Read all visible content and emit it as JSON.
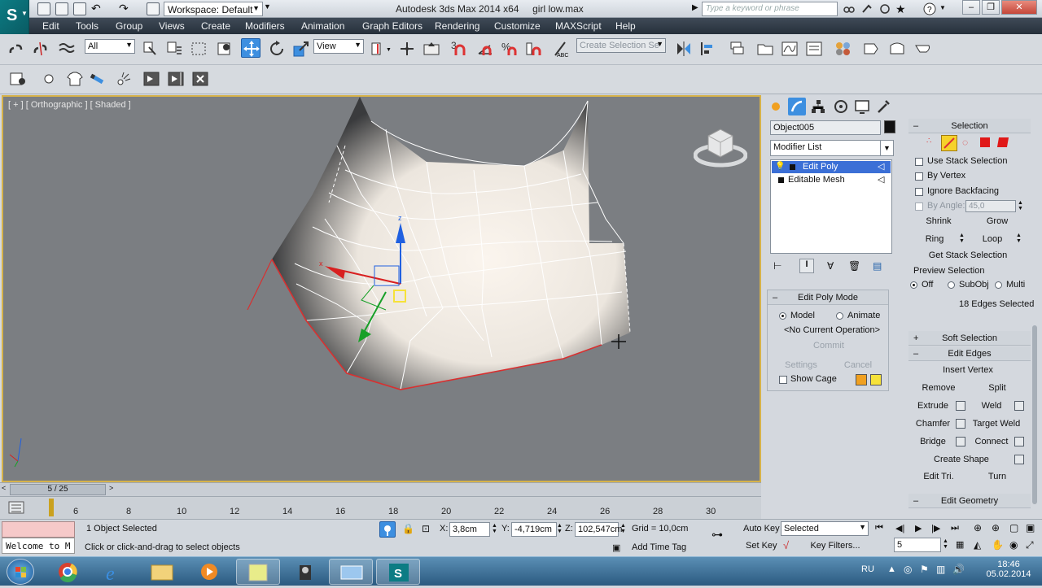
{
  "titlebar": {
    "workspace": "Workspace: Default",
    "app_title": "Autodesk 3ds Max  2014 x64",
    "file_name": "girl low.max",
    "search_placeholder": "Type a keyword or phrase"
  },
  "menu": [
    "Edit",
    "Tools",
    "Group",
    "Views",
    "Create",
    "Modifiers",
    "Animation",
    "Graph Editors",
    "Rendering",
    "Customize",
    "MAXScript",
    "Help"
  ],
  "toolbar": {
    "selection_filter": "All",
    "ref_coord": "View",
    "named_selection_placeholder": "Create Selection Se",
    "snap_number": "3"
  },
  "viewport": {
    "label": "[ + ] [ Orthographic ] [ Shaded ]"
  },
  "command_panel": {
    "object_name": "Object005",
    "modifier_list": "Modifier List",
    "stack": [
      "Edit Poly",
      "Editable Mesh"
    ],
    "edit_poly_mode": {
      "title": "Edit Poly Mode",
      "model": "Model",
      "animate": "Animate",
      "operation": "<No Current Operation>",
      "commit": "Commit",
      "settings": "Settings",
      "cancel": "Cancel",
      "show_cage": "Show Cage"
    }
  },
  "selection_rollout": {
    "title": "Selection",
    "use_stack": "Use Stack Selection",
    "by_vertex": "By Vertex",
    "ignore_backfacing": "Ignore Backfacing",
    "by_angle": "By Angle:",
    "angle_value": "45,0",
    "shrink": "Shrink",
    "grow": "Grow",
    "ring": "Ring",
    "loop": "Loop",
    "get_stack": "Get Stack Selection",
    "preview_title": "Preview Selection",
    "preview_off": "Off",
    "preview_subobj": "SubObj",
    "preview_multi": "Multi",
    "status": "18 Edges Selected"
  },
  "soft_selection": {
    "title": "Soft Selection"
  },
  "edit_edges": {
    "title": "Edit Edges",
    "insert_vertex": "Insert Vertex",
    "remove": "Remove",
    "split": "Split",
    "extrude": "Extrude",
    "weld": "Weld",
    "chamfer": "Chamfer",
    "target_weld": "Target Weld",
    "bridge": "Bridge",
    "connect": "Connect",
    "create_shape": "Create Shape",
    "edit_tri": "Edit Tri.",
    "turn": "Turn"
  },
  "edit_geometry": {
    "title": "Edit Geometry"
  },
  "timeline": {
    "frame_display": "5 / 25",
    "ticks": [
      "6",
      "8",
      "10",
      "12",
      "14",
      "16",
      "18",
      "20",
      "22",
      "24",
      "26",
      "28",
      "30"
    ]
  },
  "status": {
    "maxscript": "Welcome to M",
    "selected": "1 Object Selected",
    "prompt": "Click or click-and-drag to select objects",
    "x_label": "X:",
    "x": "3,8cm",
    "y_label": "Y:",
    "y": "-4,719cm",
    "z_label": "Z:",
    "z": "102,547cm",
    "grid": "Grid = 10,0cm",
    "add_time_tag": "Add Time Tag",
    "auto_key": "Auto Key",
    "set_key": "Set Key",
    "key_mode": "Selected",
    "key_filters": "Key Filters...",
    "frame": "5"
  },
  "taskbar": {
    "lang": "RU",
    "time": "18:46",
    "date": "05.02.2014"
  },
  "colors": {
    "menu_bg": "#2e3742",
    "viewport_bg": "#7b7e82",
    "viewport_border": "#d6b24a",
    "accent_blue": "#3d8fe0",
    "edge_red": "#d83030",
    "cage_orange": "#f0a020",
    "cage_yellow": "#f6e23a",
    "selection_blue": "#3b6fd6"
  }
}
